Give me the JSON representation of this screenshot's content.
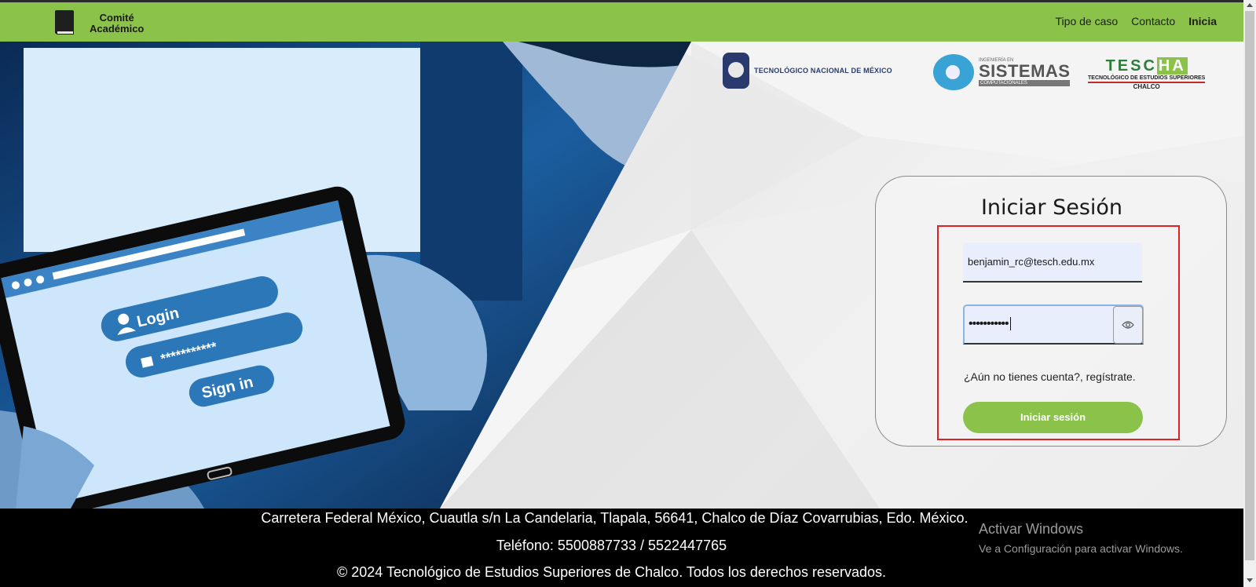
{
  "navbar": {
    "brand_line1": "Comité",
    "brand_line2": "Académico",
    "links": [
      "Tipo de caso",
      "Contacto",
      "Inicia"
    ],
    "bg_color": "#8bc34a"
  },
  "logos": {
    "tnm": "TECNOLÓGICO NACIONAL DE MÉXICO",
    "sistemas_top": "INGENIERÍA EN",
    "sistemas_main": "SISTEMAS",
    "sistemas_sub": "COMPUTACIONALES",
    "tescha_name_a": "TESC",
    "tescha_name_b": "HA",
    "tescha_line2": "TECNOLÓGICO DE ESTUDIOS SUPERIORES",
    "tescha_line3": "CHALCO"
  },
  "hero_image": {
    "login_label": "Login",
    "password_mask": "***********",
    "signin_label": "Sign in"
  },
  "login": {
    "title": "Iniciar Sesión",
    "email_value": "benjamin_rc@tesch.edu.mx",
    "password_mask": "•••••••••••",
    "signup_text": "¿Aún no tienes cuenta?, regístrate.",
    "submit_label": "Iniciar sesión",
    "accent_color": "#8bc34a",
    "highlight_color": "#e31e24"
  },
  "footer": {
    "address": "Carretera Federal México, Cuautla s/n La Candelaria, Tlapala, 56641, Chalco de Díaz Covarrubias, Edo. México.",
    "phone": "Teléfono: 5500887733 / 5522447765",
    "copyright": "© 2024 Tecnológico de Estudios Superiores de Chalco. Todos los derechos reservados."
  },
  "windows_watermark": {
    "line1": "Activar Windows",
    "line2": "Ve a Configuración para activar Windows."
  }
}
